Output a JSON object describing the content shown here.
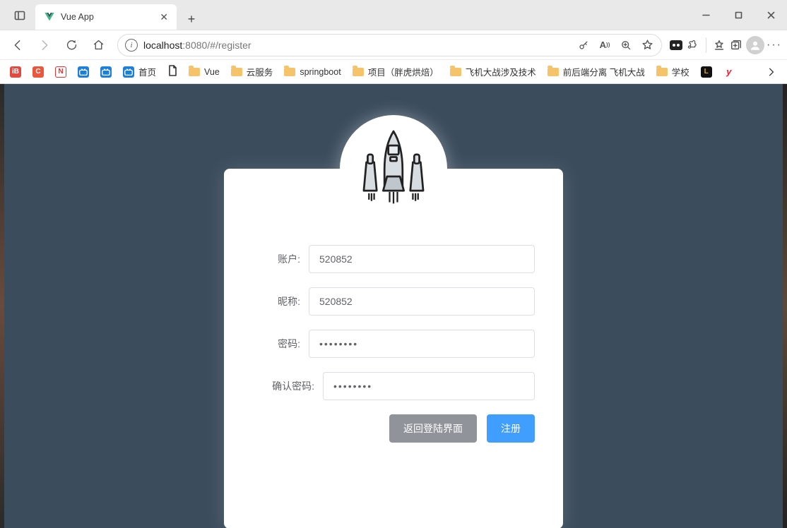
{
  "window": {
    "tab_title": "Vue App"
  },
  "addressbar": {
    "url_prefix": "localhost",
    "url_rest": ":8080/#/register"
  },
  "bookmarks": {
    "home": "首页",
    "vue": "Vue",
    "cloud": "云服务",
    "springboot": "springboot",
    "project": "项目（胖虎烘焙）",
    "plane_tech": "飞机大战涉及技术",
    "separation": "前后端分离 飞机大战",
    "school": "学校"
  },
  "form": {
    "labels": {
      "account": "账户:",
      "nickname": "昵称:",
      "password": "密码:",
      "confirm": "确认密码:"
    },
    "values": {
      "account": "520852",
      "nickname": "520852",
      "password": "••••••••",
      "confirm": "••••••••"
    },
    "buttons": {
      "back": "返回登陆界面",
      "register": "注册"
    }
  }
}
